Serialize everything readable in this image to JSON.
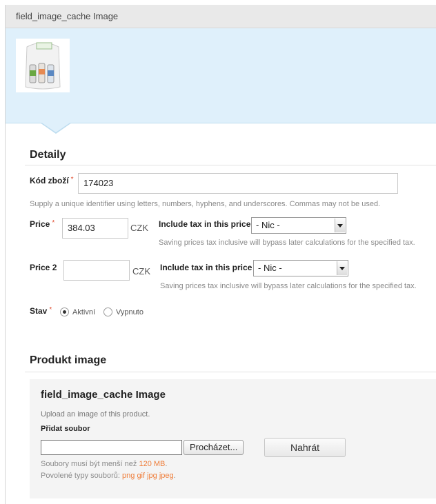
{
  "header": {
    "title": "field_image_cache Image"
  },
  "preview": {
    "image_alt": "product-thumbnail"
  },
  "details": {
    "heading": "Detaily",
    "code": {
      "label": "Kód zboží",
      "value": "174023",
      "help": "Supply a unique identifier using letters, numbers, hyphens, and underscores. Commas may not be used."
    },
    "price": {
      "label": "Price",
      "value": "384.03",
      "unit": "CZK",
      "tax_label": "Include tax in this price",
      "tax_value": "- Nic -",
      "help": "Saving prices tax inclusive will bypass later calculations for the specified tax."
    },
    "price2": {
      "label": "Price 2",
      "value": "",
      "unit": "CZK",
      "tax_label": "Include tax in this price",
      "tax_value": "- Nic -",
      "help": "Saving prices tax inclusive will bypass later calculations for the specified tax."
    },
    "status": {
      "label": "Stav",
      "options": [
        "Aktivní",
        "Vypnuto"
      ],
      "selected": "Aktivní"
    },
    "required_mark": "*"
  },
  "product_image": {
    "heading": "Produkt image",
    "panel_title": "field_image_cache Image",
    "help": "Upload an image of this product.",
    "add_file_label": "Přidat soubor",
    "browse_label": "Procházet...",
    "upload_label": "Nahrát",
    "size_note_prefix": "Soubory musí být menší než",
    "size_limit": "120 MB",
    "size_note_suffix": ".",
    "types_prefix": "Povolené typy souborů:",
    "types": "png gif jpg jpeg",
    "types_suffix": "."
  },
  "colors": {
    "accent": "#ef7d39",
    "required": "#e04a2c",
    "preview_bg": "#dff0fb"
  }
}
